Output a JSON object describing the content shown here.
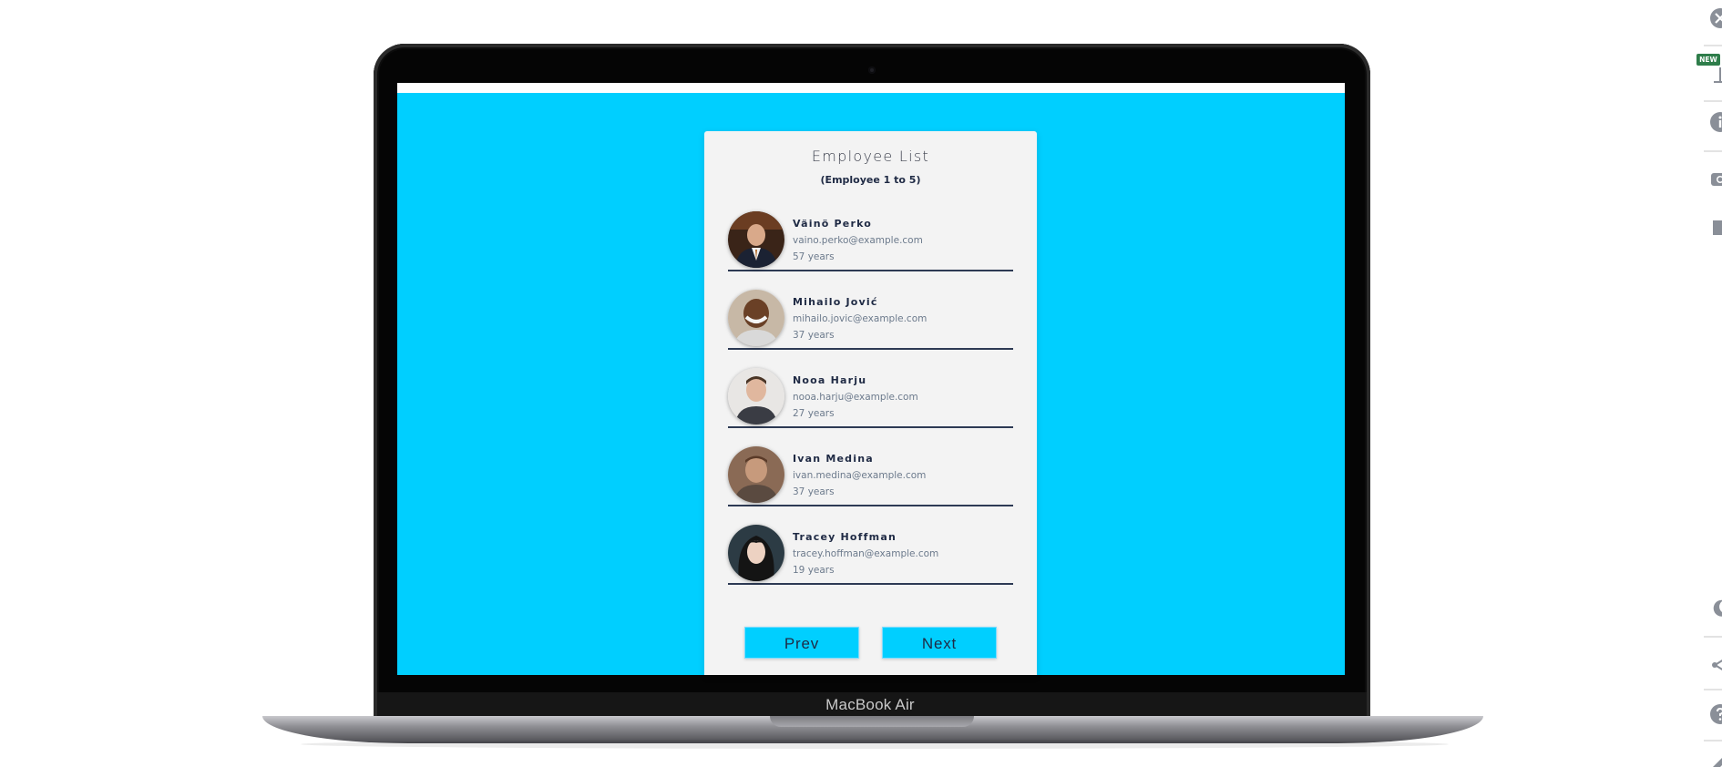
{
  "device": {
    "label": "MacBook Air"
  },
  "card": {
    "title": "Employee List",
    "subtitle": "(Employee 1 to 5)"
  },
  "employees": [
    {
      "name": "Väinö Perko",
      "email": "vaino.perko@example.com",
      "age": "57 years",
      "avatar_icon": "person-photo-suit"
    },
    {
      "name": "Mihailo Jović",
      "email": "mihailo.jovic@example.com",
      "age": "37 years",
      "avatar_icon": "person-photo-smiling"
    },
    {
      "name": "Nooa Harju",
      "email": "nooa.harju@example.com",
      "age": "27 years",
      "avatar_icon": "person-photo-light"
    },
    {
      "name": "Ivan Medina",
      "email": "ivan.medina@example.com",
      "age": "37 years",
      "avatar_icon": "person-photo-brown"
    },
    {
      "name": "Tracey Hoffman",
      "email": "tracey.hoffman@example.com",
      "age": "19 years",
      "avatar_icon": "person-photo-dark-hair"
    }
  ],
  "pagination": {
    "prev_label": "Prev",
    "next_label": "Next"
  },
  "toolbar": {
    "new_badge": "NEW",
    "icons": [
      "close-icon",
      "presentation-icon",
      "info-icon",
      "camera-icon",
      "stop-icon",
      "moon-icon",
      "share-icon",
      "help-icon",
      "edit-icon"
    ]
  },
  "colors": {
    "screen_background": "#00cfff",
    "card_background": "#f3f3f3",
    "text_primary": "#1f2a44",
    "text_secondary": "#6c7a8c",
    "divider": "#2d3a54",
    "button": "#00cfff",
    "badge": "#2e7d4a"
  }
}
